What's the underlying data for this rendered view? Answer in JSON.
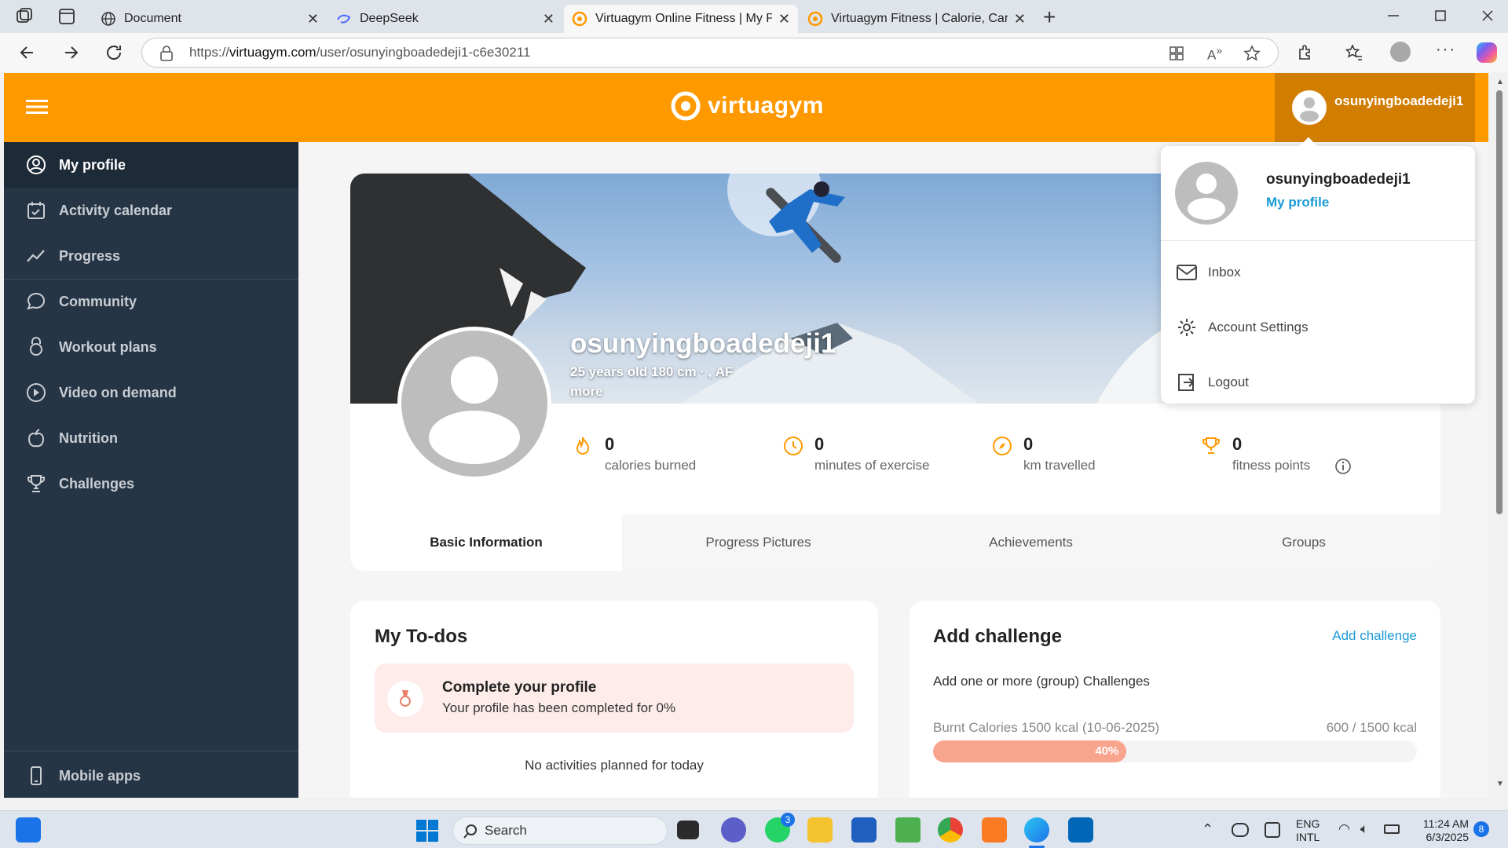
{
  "browser": {
    "tabs": [
      {
        "title": "Document"
      },
      {
        "title": "DeepSeek"
      },
      {
        "title": "Virtuagym Online Fitness | My Pro"
      },
      {
        "title": "Virtuagym Fitness | Calorie, Carb &"
      }
    ],
    "url_prefix": "https://",
    "url_domain": "virtuagym.com",
    "url_path": "/user/osunyingboadedeji1-c6e30211"
  },
  "header": {
    "logo_text": "virtuagym",
    "username": "osunyingboadedeji1",
    "accent": "#ff9900"
  },
  "sidebar": {
    "items": [
      {
        "label": "My profile",
        "icon": "user-circle-icon"
      },
      {
        "label": "Activity calendar",
        "icon": "calendar-icon"
      },
      {
        "label": "Progress",
        "icon": "trend-icon"
      },
      {
        "label": "Community",
        "icon": "chat-icon"
      },
      {
        "label": "Workout plans",
        "icon": "kettlebell-icon"
      },
      {
        "label": "Video on demand",
        "icon": "play-icon"
      },
      {
        "label": "Nutrition",
        "icon": "apple-icon"
      },
      {
        "label": "Challenges",
        "icon": "trophy-icon"
      }
    ],
    "mobile_apps": "Mobile apps"
  },
  "profile": {
    "name": "osunyingboadedeji1",
    "details": "25 years old 180 cm · , AF",
    "more": "more",
    "stats": [
      {
        "value": "0",
        "label": "calories burned",
        "icon": "flame-icon"
      },
      {
        "value": "0",
        "label": "minutes of exercise",
        "icon": "clock-icon"
      },
      {
        "value": "0",
        "label": "km travelled",
        "icon": "compass-icon"
      },
      {
        "value": "0",
        "label": "fitness points",
        "icon": "trophy-icon"
      }
    ],
    "tabs": [
      "Basic Information",
      "Progress Pictures",
      "Achievements",
      "Groups"
    ]
  },
  "todos": {
    "title": "My To-dos",
    "item_title": "Complete your profile",
    "item_sub": "Your profile has been completed for 0%",
    "empty": "No activities planned for today"
  },
  "challenge": {
    "title": "Add challenge",
    "link": "Add challenge",
    "desc": "Add one or more (group) Challenges",
    "name": "Burnt Calories 1500 kcal (10-06-2025)",
    "amount": "600 / 1500 kcal",
    "percent_label": "40%",
    "progress": 0.4
  },
  "dropdown": {
    "username": "osunyingboadedeji1",
    "my_profile": "My profile",
    "items": [
      {
        "label": "Inbox",
        "icon": "mail-icon"
      },
      {
        "label": "Account Settings",
        "icon": "gear-icon"
      },
      {
        "label": "Logout",
        "icon": "logout-icon"
      }
    ]
  },
  "taskbar": {
    "search": "Search",
    "lang1": "ENG",
    "lang2": "INTL",
    "time": "11:24 AM",
    "date": "6/3/2025",
    "whatsapp_badge": "3",
    "notif_count": "8"
  }
}
